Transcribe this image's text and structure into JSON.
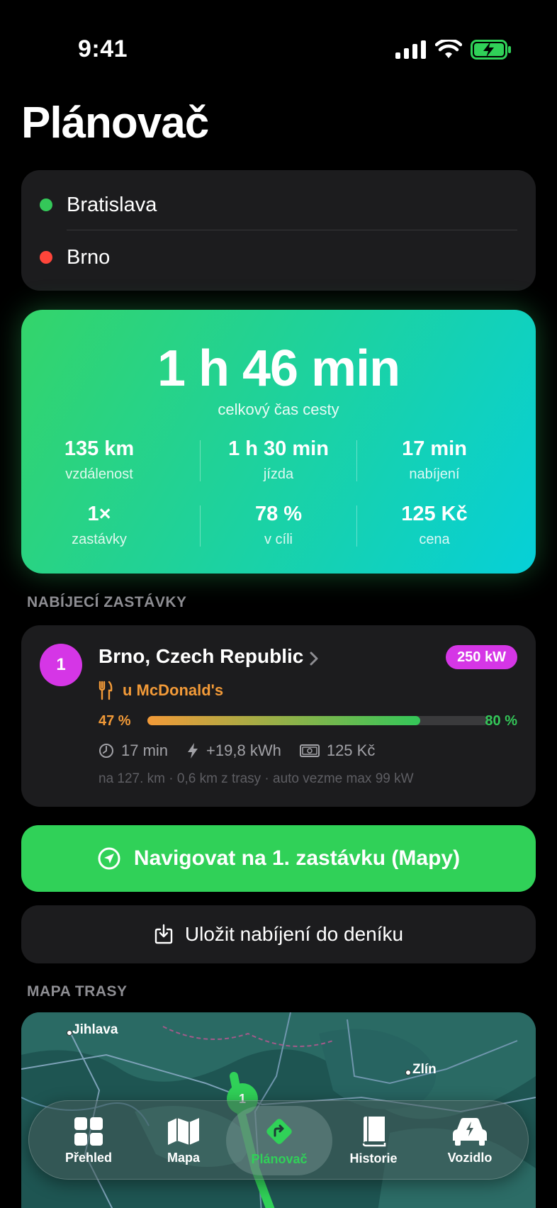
{
  "status": {
    "time": "9:41"
  },
  "page": {
    "title": "Plánovač"
  },
  "route": {
    "origin": "Bratislava",
    "destination": "Brno"
  },
  "summary": {
    "total_time": "1 h 46 min",
    "total_label": "celkový čas cesty",
    "stats": [
      {
        "value": "135 km",
        "label": "vzdálenost"
      },
      {
        "value": "1 h 30 min",
        "label": "jízda"
      },
      {
        "value": "17 min",
        "label": "nabíjení"
      },
      {
        "value": "1×",
        "label": "zastávky"
      },
      {
        "value": "78 %",
        "label": "v cíli"
      },
      {
        "value": "125 Kč",
        "label": "cena"
      }
    ]
  },
  "stops_section": {
    "title": "NABÍJECÍ ZASTÁVKY"
  },
  "stop": {
    "number": "1",
    "name": "Brno, Czech Republic",
    "power": "250 kW",
    "amenity": "u McDonald's",
    "soc_start": "47 %",
    "soc_end": "80 %",
    "soc_start_fraction": 0.47,
    "soc_end_fraction": 0.8,
    "duration": "17 min",
    "energy": "+19,8 kWh",
    "cost": "125 Kč",
    "footer": "na 127. km  · 0,6 km z trasy  · auto vezme max 99 kW"
  },
  "actions": {
    "navigate_label": "Navigovat na 1. zastávku (Mapy)",
    "save_label": "Uložit nabíjení do deníku"
  },
  "map_section": {
    "title": "MAPA TRASY",
    "labels": [
      "Jihlava",
      "Zlín"
    ],
    "marker": "1"
  },
  "tabs": [
    {
      "label": "Přehled",
      "icon": "grid-icon"
    },
    {
      "label": "Mapa",
      "icon": "map-icon"
    },
    {
      "label": "Plánovač",
      "icon": "route-icon",
      "active": true
    },
    {
      "label": "Historie",
      "icon": "book-icon"
    },
    {
      "label": "Vozidlo",
      "icon": "car-bolt-icon"
    }
  ],
  "colors": {
    "accent_green": "#30d158",
    "origin_dot": "#34c759",
    "destination_dot": "#ff453a",
    "stop_magenta": "#d536e6",
    "amenity_orange": "#f29a38"
  }
}
